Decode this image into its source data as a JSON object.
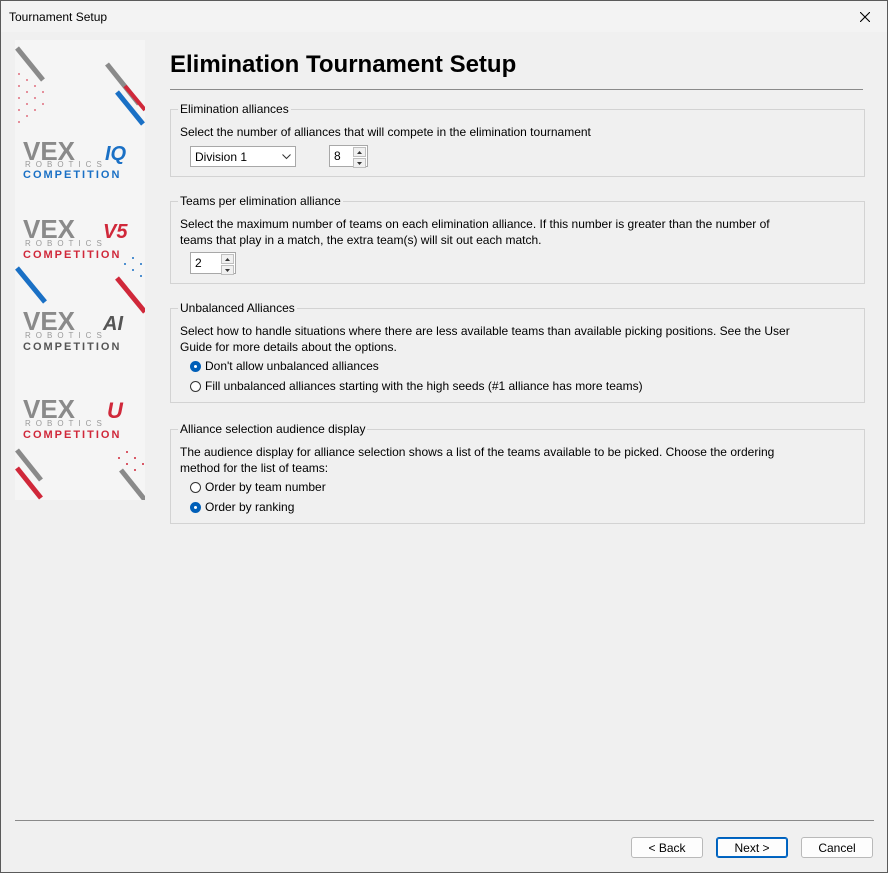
{
  "window": {
    "title": "Tournament Setup"
  },
  "page": {
    "heading": "Elimination Tournament Setup"
  },
  "sidebar": {
    "logos": [
      {
        "brand": "VEX",
        "model": "IQ",
        "subtitle": "ROBOTICS",
        "competition": "COMPETITION",
        "color": "#1a70c5"
      },
      {
        "brand": "VEX",
        "model": "V5",
        "subtitle": "ROBOTICS",
        "competition": "COMPETITION",
        "color": "#d0283a"
      },
      {
        "brand": "VEX",
        "model": "AI",
        "subtitle": "ROBOTICS",
        "competition": "COMPETITION",
        "color": "#6a6a6a"
      },
      {
        "brand": "VEX",
        "model": "U",
        "subtitle": "ROBOTICS",
        "competition": "COMPETITION",
        "color": "#d0283a"
      }
    ]
  },
  "alliances": {
    "title": "Elimination alliances",
    "desc": "Select the number of alliances that will compete in the elimination tournament",
    "division": "Division 1",
    "count": "8"
  },
  "teams_per": {
    "title": "Teams per elimination alliance",
    "desc1": "Select the maximum number of teams on each elimination alliance.  If this number is greater than the number of",
    "desc2": "teams that play in a match, the extra team(s) will sit out each match.",
    "count": "2"
  },
  "unbalanced": {
    "title": "Unbalanced Alliances",
    "desc1": "Select how to handle situations where there are less available teams than available picking positions.  See the User",
    "desc2": "Guide for more details about the options.",
    "option1": "Don't allow unbalanced alliances",
    "option2": "Fill unbalanced alliances starting with the high seeds (#1 alliance has more teams)",
    "selected": 1
  },
  "audience": {
    "title": "Alliance selection audience display",
    "desc1": "The audience display for alliance selection shows a list of the teams available to be picked.  Choose the ordering",
    "desc2": "method for the list of teams:",
    "option1": "Order by team number",
    "option2": "Order by ranking",
    "selected": 2
  },
  "buttons": {
    "back": "< Back",
    "next": "Next >",
    "cancel": "Cancel"
  },
  "colors": {
    "accent": "#005fb8",
    "vex_blue": "#1a70c5",
    "vex_red": "#d0283a"
  }
}
